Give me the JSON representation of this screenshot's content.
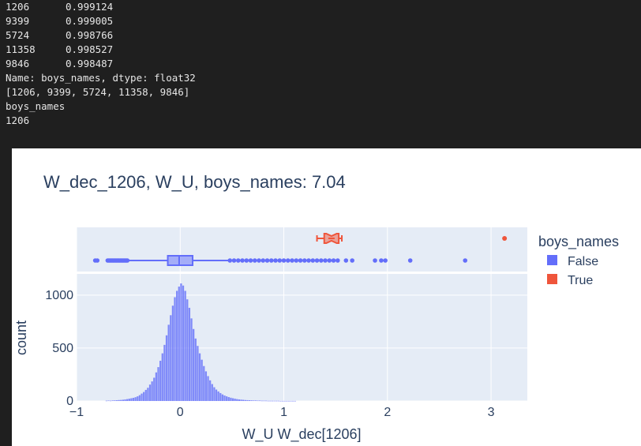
{
  "console": {
    "series_rows": [
      {
        "index": "1206",
        "value": "0.999124"
      },
      {
        "index": "9399",
        "value": "0.999005"
      },
      {
        "index": "5724",
        "value": "0.998766"
      },
      {
        "index": "11358",
        "value": "0.998527"
      },
      {
        "index": "9846",
        "value": "0.998487"
      }
    ],
    "series_footer": "Name: boys_names, dtype: float32",
    "list_output": "[1206, 9399, 5724, 11358, 9846]",
    "feature_name": "boys_names",
    "feature_index": "1206"
  },
  "colors": {
    "false_series": "#636efa",
    "true_series": "#ef553b",
    "plot_bg": "#e5ecf6",
    "grid": "#ffffff",
    "text": "#2a3f5f"
  },
  "chart_data": {
    "type": "histogram",
    "title": "W_dec_1206, W_U, boys_names: 7.04",
    "xlabel": "W_U W_dec[1206]",
    "ylabel": "count",
    "xlim": [
      -1,
      3.35
    ],
    "ylim": [
      0,
      1200
    ],
    "x_ticks": [
      "−1",
      "0",
      "1",
      "2",
      "3"
    ],
    "y_ticks": [
      "0",
      "500",
      "1000"
    ],
    "legend": {
      "title": "boys_names",
      "position": "right",
      "entries": [
        "False",
        "True"
      ]
    },
    "histogram": {
      "series": "False",
      "bin_width": 0.02,
      "bins": [
        {
          "x": -0.72,
          "count": 3
        },
        {
          "x": -0.7,
          "count": 4
        },
        {
          "x": -0.68,
          "count": 3
        },
        {
          "x": -0.66,
          "count": 5
        },
        {
          "x": -0.64,
          "count": 6
        },
        {
          "x": -0.62,
          "count": 7
        },
        {
          "x": -0.6,
          "count": 9
        },
        {
          "x": -0.58,
          "count": 10
        },
        {
          "x": -0.56,
          "count": 12
        },
        {
          "x": -0.54,
          "count": 15
        },
        {
          "x": -0.52,
          "count": 18
        },
        {
          "x": -0.5,
          "count": 22
        },
        {
          "x": -0.48,
          "count": 26
        },
        {
          "x": -0.46,
          "count": 30
        },
        {
          "x": -0.44,
          "count": 36
        },
        {
          "x": -0.42,
          "count": 44
        },
        {
          "x": -0.4,
          "count": 55
        },
        {
          "x": -0.38,
          "count": 70
        },
        {
          "x": -0.36,
          "count": 85
        },
        {
          "x": -0.34,
          "count": 105
        },
        {
          "x": -0.32,
          "count": 125
        },
        {
          "x": -0.3,
          "count": 155
        },
        {
          "x": -0.28,
          "count": 185
        },
        {
          "x": -0.26,
          "count": 220
        },
        {
          "x": -0.24,
          "count": 270
        },
        {
          "x": -0.22,
          "count": 320
        },
        {
          "x": -0.2,
          "count": 380
        },
        {
          "x": -0.18,
          "count": 450
        },
        {
          "x": -0.16,
          "count": 530
        },
        {
          "x": -0.14,
          "count": 620
        },
        {
          "x": -0.12,
          "count": 720
        },
        {
          "x": -0.1,
          "count": 810
        },
        {
          "x": -0.08,
          "count": 900
        },
        {
          "x": -0.06,
          "count": 980
        },
        {
          "x": -0.04,
          "count": 1040
        },
        {
          "x": -0.02,
          "count": 1080
        },
        {
          "x": 0.0,
          "count": 1110
        },
        {
          "x": 0.02,
          "count": 1090
        },
        {
          "x": 0.04,
          "count": 1040
        },
        {
          "x": 0.06,
          "count": 960
        },
        {
          "x": 0.08,
          "count": 880
        },
        {
          "x": 0.1,
          "count": 780
        },
        {
          "x": 0.12,
          "count": 680
        },
        {
          "x": 0.14,
          "count": 590
        },
        {
          "x": 0.16,
          "count": 520
        },
        {
          "x": 0.18,
          "count": 450
        },
        {
          "x": 0.2,
          "count": 390
        },
        {
          "x": 0.22,
          "count": 330
        },
        {
          "x": 0.24,
          "count": 280
        },
        {
          "x": 0.26,
          "count": 235
        },
        {
          "x": 0.28,
          "count": 195
        },
        {
          "x": 0.3,
          "count": 160
        },
        {
          "x": 0.32,
          "count": 130
        },
        {
          "x": 0.34,
          "count": 108
        },
        {
          "x": 0.36,
          "count": 90
        },
        {
          "x": 0.38,
          "count": 75
        },
        {
          "x": 0.4,
          "count": 62
        },
        {
          "x": 0.42,
          "count": 52
        },
        {
          "x": 0.44,
          "count": 44
        },
        {
          "x": 0.46,
          "count": 37
        },
        {
          "x": 0.48,
          "count": 31
        },
        {
          "x": 0.5,
          "count": 26
        },
        {
          "x": 0.52,
          "count": 22
        },
        {
          "x": 0.54,
          "count": 18
        },
        {
          "x": 0.56,
          "count": 15
        },
        {
          "x": 0.58,
          "count": 13
        },
        {
          "x": 0.6,
          "count": 11
        },
        {
          "x": 0.62,
          "count": 9
        },
        {
          "x": 0.64,
          "count": 8
        },
        {
          "x": 0.66,
          "count": 7
        },
        {
          "x": 0.68,
          "count": 6
        },
        {
          "x": 0.7,
          "count": 5
        },
        {
          "x": 0.72,
          "count": 5
        },
        {
          "x": 0.74,
          "count": 4
        },
        {
          "x": 0.76,
          "count": 4
        },
        {
          "x": 0.78,
          "count": 3
        },
        {
          "x": 0.8,
          "count": 3
        },
        {
          "x": 0.82,
          "count": 3
        },
        {
          "x": 0.84,
          "count": 2
        },
        {
          "x": 0.86,
          "count": 2
        },
        {
          "x": 0.88,
          "count": 2
        },
        {
          "x": 0.9,
          "count": 2
        },
        {
          "x": 0.92,
          "count": 2
        },
        {
          "x": 0.94,
          "count": 2
        },
        {
          "x": 0.96,
          "count": 1
        },
        {
          "x": 0.98,
          "count": 1
        },
        {
          "x": 1.0,
          "count": 1
        },
        {
          "x": 1.02,
          "count": 1
        },
        {
          "x": 1.04,
          "count": 1
        },
        {
          "x": 1.06,
          "count": 1
        },
        {
          "x": 1.08,
          "count": 1
        },
        {
          "x": 1.1,
          "count": 1
        }
      ]
    },
    "box_false": {
      "series": "False",
      "min": -0.82,
      "lower_fence": -0.5,
      "q1": -0.12,
      "median": -0.01,
      "q3": 0.12,
      "upper_fence": 0.47,
      "outliers": [
        -0.82,
        -0.8,
        -0.7,
        -0.69,
        -0.68,
        -0.67,
        -0.66,
        -0.65,
        -0.64,
        -0.63,
        -0.62,
        -0.61,
        -0.6,
        -0.59,
        -0.58,
        -0.57,
        -0.56,
        -0.55,
        -0.54,
        -0.53,
        -0.52,
        -0.51,
        0.48,
        0.52,
        0.56,
        0.6,
        0.64,
        0.68,
        0.72,
        0.76,
        0.8,
        0.84,
        0.88,
        0.92,
        0.96,
        1.0,
        1.04,
        1.08,
        1.12,
        1.16,
        1.2,
        1.24,
        1.28,
        1.32,
        1.36,
        1.4,
        1.44,
        1.48,
        1.52,
        1.6,
        1.66,
        1.88,
        1.94,
        1.98,
        2.22,
        2.75
      ]
    },
    "box_true": {
      "series": "True",
      "lower_fence": 1.32,
      "q1": 1.39,
      "median": 1.46,
      "q3": 1.53,
      "upper_fence": 1.56,
      "notch_half_width": 0.05,
      "outliers": [
        3.13
      ]
    }
  }
}
